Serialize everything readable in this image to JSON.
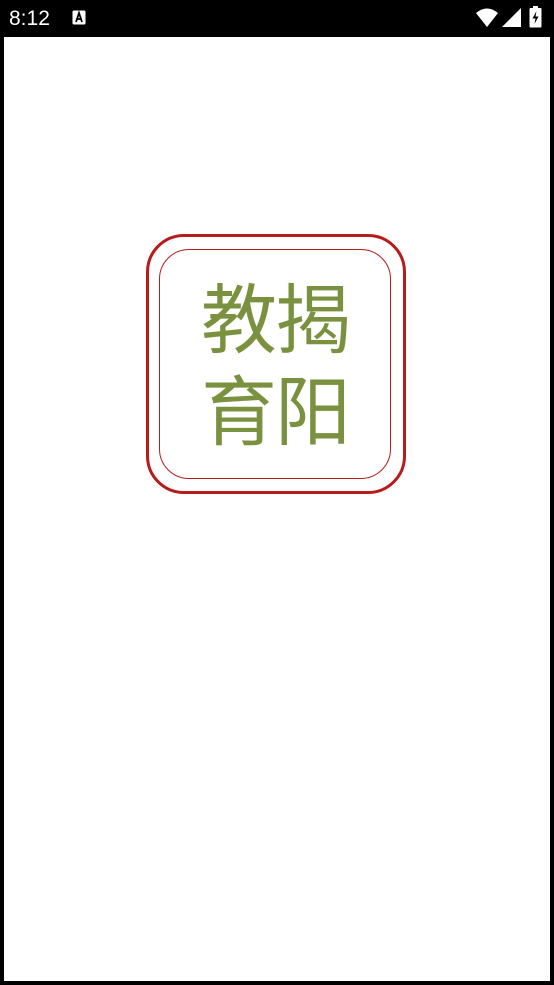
{
  "status_bar": {
    "time": "8:12",
    "notification_icon": "accessibility-a-icon",
    "wifi_icon": "wifi-icon",
    "signal_icon": "cell-signal-icon",
    "battery_icon": "battery-charging-icon"
  },
  "splash": {
    "logo_line_1": "教揭",
    "logo_line_2": "育阳",
    "border_color": "#b71c1c",
    "text_color": "#7a923f"
  }
}
